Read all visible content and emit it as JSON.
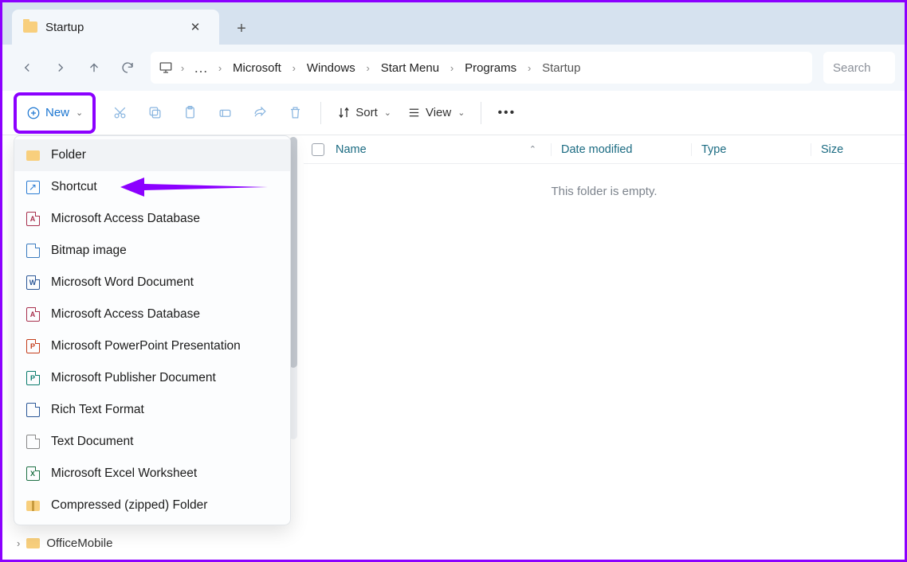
{
  "tab": {
    "title": "Startup"
  },
  "breadcrumb": {
    "segments": [
      "Microsoft",
      "Windows",
      "Start Menu",
      "Programs"
    ],
    "current": "Startup"
  },
  "search": {
    "placeholder": "Search"
  },
  "toolbar": {
    "new_label": "New",
    "sort_label": "Sort",
    "view_label": "View"
  },
  "new_menu": {
    "items": [
      {
        "label": "Folder",
        "icon": "folder"
      },
      {
        "label": "Shortcut",
        "icon": "shortcut"
      },
      {
        "label": "Microsoft Access Database",
        "icon": "access"
      },
      {
        "label": "Bitmap image",
        "icon": "bitmap"
      },
      {
        "label": "Microsoft Word Document",
        "icon": "word"
      },
      {
        "label": "Microsoft Access Database",
        "icon": "access"
      },
      {
        "label": "Microsoft PowerPoint Presentation",
        "icon": "ppt"
      },
      {
        "label": "Microsoft Publisher Document",
        "icon": "pub"
      },
      {
        "label": "Rich Text Format",
        "icon": "rtf"
      },
      {
        "label": "Text Document",
        "icon": "txt"
      },
      {
        "label": "Microsoft Excel Worksheet",
        "icon": "xls"
      },
      {
        "label": "Compressed (zipped) Folder",
        "icon": "zip"
      }
    ]
  },
  "sidebar": {
    "visible_item": "OfficeMobile"
  },
  "columns": {
    "name": "Name",
    "date": "Date modified",
    "type": "Type",
    "size": "Size"
  },
  "content": {
    "empty_msg": "This folder is empty."
  },
  "annotation": {
    "highlight": "new-button",
    "arrow_target": "Shortcut"
  }
}
